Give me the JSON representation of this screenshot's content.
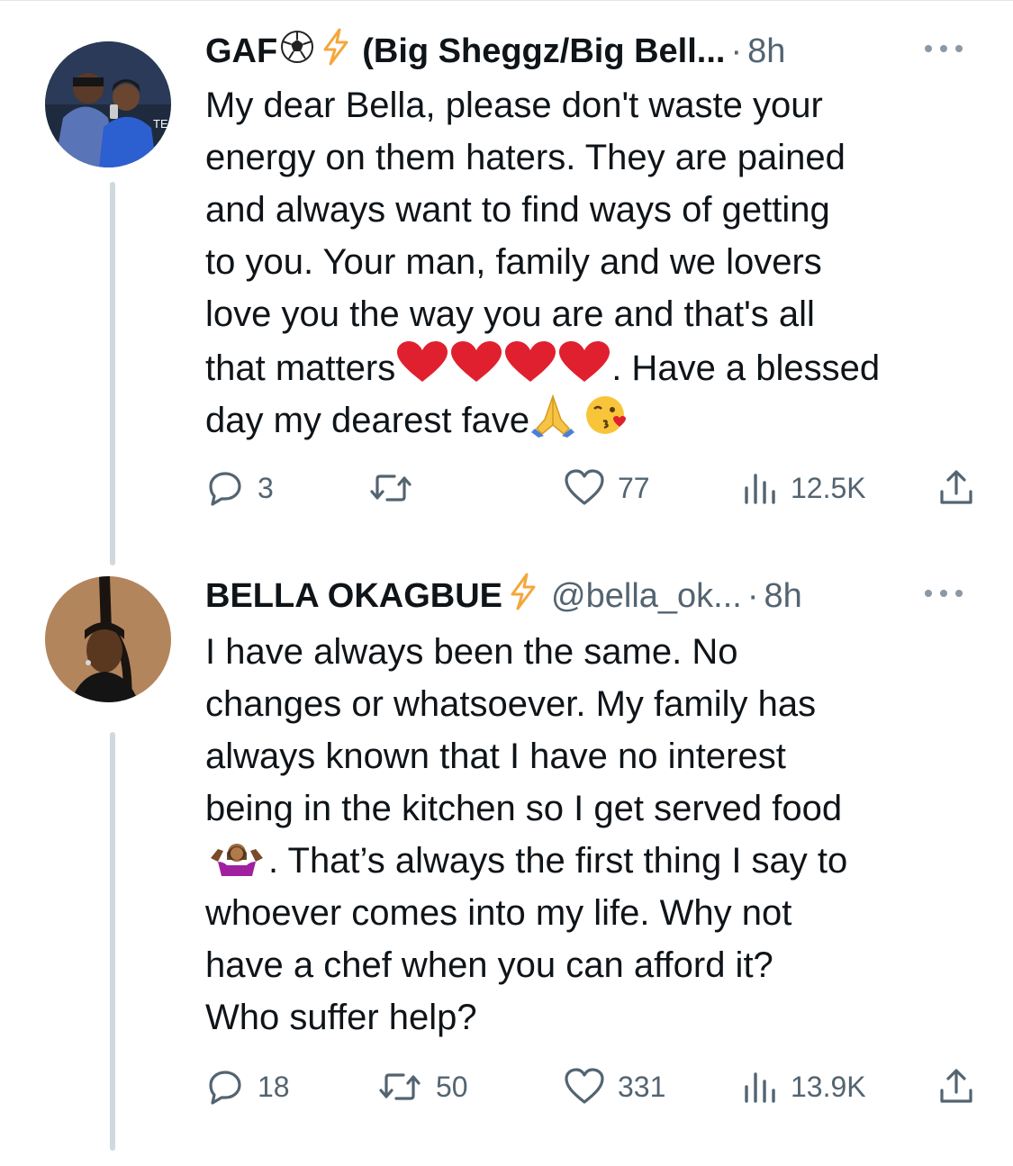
{
  "tweets": [
    {
      "name": "GAF",
      "handle": "(Big Sheggz/Big Bell...",
      "time": "8h",
      "lines": [
        "My dear Bella, please don't waste your",
        "energy on them haters. They are pained",
        "and always want to find ways of getting",
        "to you. Your man, family and we lovers",
        "love you the way you are and that's all",
        "that matters",
        ". Have a blessed",
        "day my dearest fave"
      ],
      "replies": "3",
      "retweets": "",
      "likes": "77",
      "views": "12.5K"
    },
    {
      "name": "BELLA OKAGBUE",
      "handle": "@bella_ok...",
      "time": "8h",
      "lines": [
        "I have always been the same. No",
        "changes or whatsoever. My family has",
        "always known that I have no interest",
        "being in the kitchen so I get served food",
        ". That’s always the first thing I say to",
        "whoever comes into my life. Why not",
        "have a chef when you can afford it?",
        "Who suffer help?"
      ],
      "replies": "18",
      "retweets": "50",
      "likes": "331",
      "views": "13.9K"
    }
  ],
  "icons": {
    "verified": "lightning-bolt-icon",
    "soccer": "soccer-ball-icon",
    "reply": "reply-icon",
    "retweet": "retweet-icon",
    "like": "heart-outline-icon",
    "views": "views-bar-icon",
    "share": "share-icon"
  },
  "colors": {
    "text": "#0f1419",
    "muted": "#536471",
    "bolt": "#f4a73b",
    "heart": "#e0202f"
  }
}
